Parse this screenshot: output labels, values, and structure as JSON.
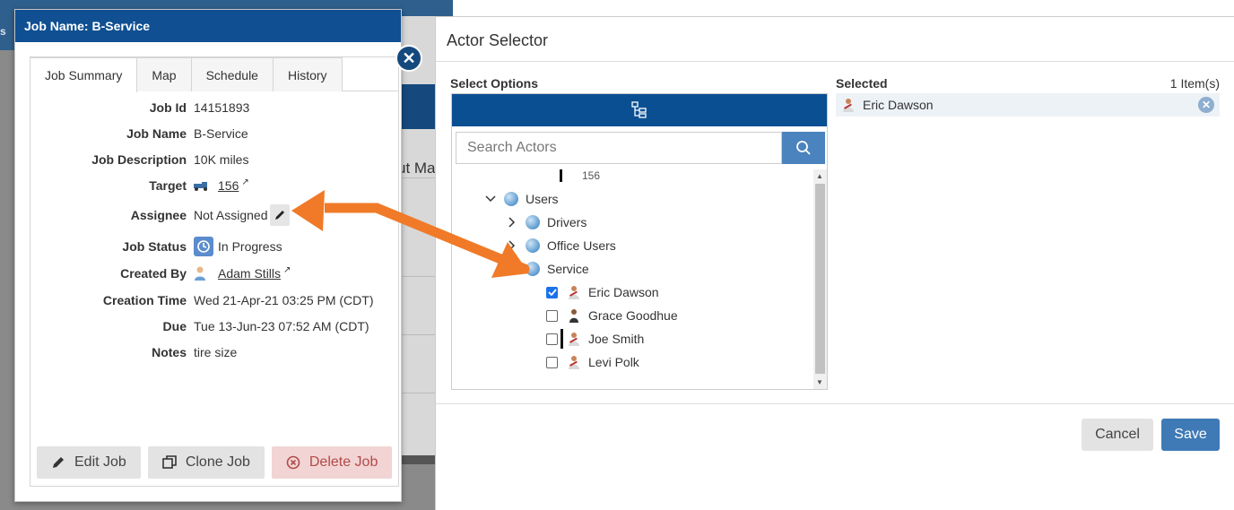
{
  "background": {
    "edge_letter": "s",
    "partial_text": "ut Ma"
  },
  "job_modal": {
    "title": "Job Name: B-Service",
    "tabs": [
      {
        "label": "Job Summary",
        "active": true
      },
      {
        "label": "Map",
        "active": false
      },
      {
        "label": "Schedule",
        "active": false
      },
      {
        "label": "History",
        "active": false
      }
    ],
    "fields": {
      "job_id": {
        "label": "Job Id",
        "value": "14151893"
      },
      "job_name": {
        "label": "Job Name",
        "value": "B-Service"
      },
      "job_description": {
        "label": "Job Description",
        "value": "10K miles"
      },
      "target": {
        "label": "Target",
        "value": "156",
        "icon": "truck-icon"
      },
      "assignee": {
        "label": "Assignee",
        "value": "Not Assigned",
        "icon": "pencil-icon"
      },
      "job_status": {
        "label": "Job Status",
        "value": "In Progress",
        "icon": "clock-icon"
      },
      "created_by": {
        "label": "Created By",
        "value": "Adam Stills",
        "icon": "user-icon"
      },
      "creation_time": {
        "label": "Creation Time",
        "value": "Wed 21-Apr-21 03:25 PM (CDT)"
      },
      "due": {
        "label": "Due",
        "value": "Tue 13-Jun-23 07:52 AM (CDT)"
      },
      "notes": {
        "label": "Notes",
        "value": "tire size"
      }
    },
    "buttons": {
      "edit": "Edit Job",
      "clone": "Clone Job",
      "delete": "Delete Job"
    }
  },
  "actor_selector": {
    "title": "Actor Selector",
    "select_options_label": "Select Options",
    "search_placeholder": "Search Actors",
    "tree": {
      "partial_item": "156",
      "groups": [
        {
          "label": "Users",
          "expanded": true
        },
        {
          "label": "Drivers",
          "expanded": false
        },
        {
          "label": "Office Users",
          "expanded": false
        },
        {
          "label": "Service",
          "expanded": true
        }
      ],
      "actors": [
        {
          "label": "Eric Dawson",
          "checked": true
        },
        {
          "label": "Grace Goodhue",
          "checked": false
        },
        {
          "label": "Joe Smith",
          "checked": false
        },
        {
          "label": "Levi Polk",
          "checked": false
        }
      ]
    },
    "selected_label": "Selected",
    "selected_count": "1 Item(s)",
    "selected_items": [
      {
        "label": "Eric Dawson"
      }
    ],
    "buttons": {
      "cancel": "Cancel",
      "save": "Save"
    }
  },
  "colors": {
    "header_blue": "#0f4f92",
    "save_blue": "#3f7ab6",
    "arrow_orange": "#f07a28",
    "delete_red": "#b24a4a"
  }
}
